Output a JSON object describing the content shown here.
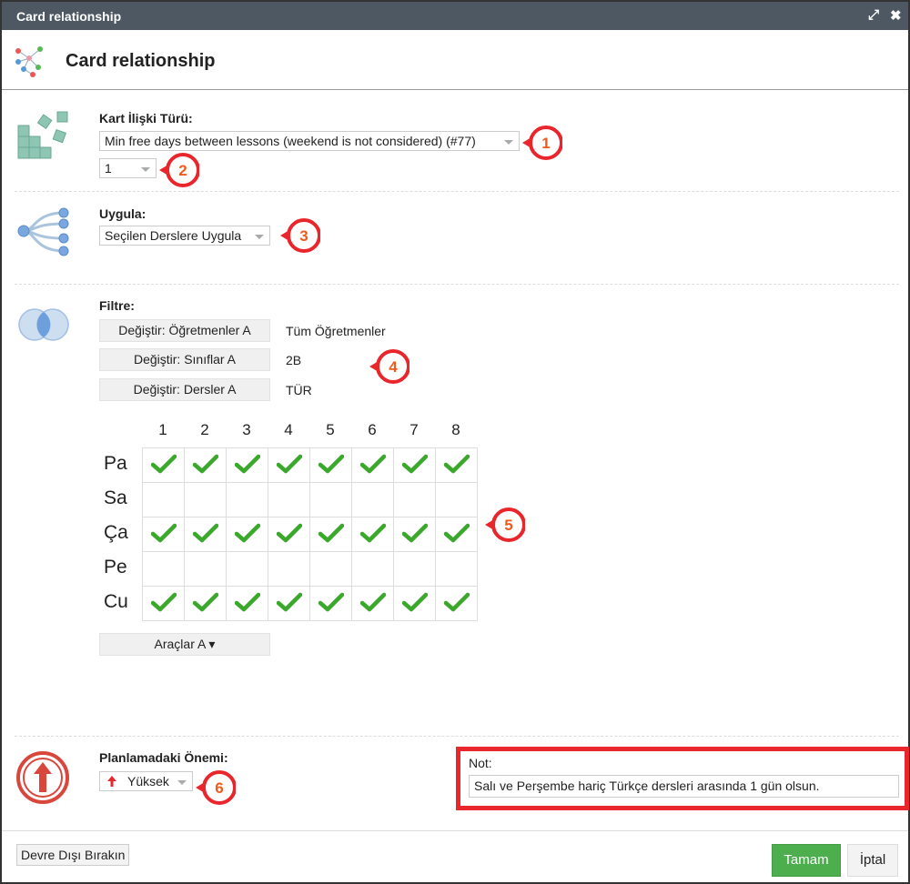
{
  "window": {
    "title": "Card relationship"
  },
  "header": {
    "title": "Card relationship"
  },
  "relation": {
    "label": "Kart İlişki Türü:",
    "type_value": "Min free days between lessons (weekend is not considered) (#77)",
    "count_value": "1"
  },
  "apply": {
    "label": "Uygula:",
    "value": "Seçilen Derslere Uygula"
  },
  "filter": {
    "label": "Filtre:",
    "rows": [
      {
        "button": "Değiştir: Öğretmenler A",
        "value": "Tüm Öğretmenler"
      },
      {
        "button": "Değiştir: Sınıflar A",
        "value": "2B"
      },
      {
        "button": "Değiştir: Dersler A",
        "value": "TÜR"
      }
    ]
  },
  "grid": {
    "columns": [
      "1",
      "2",
      "3",
      "4",
      "5",
      "6",
      "7",
      "8"
    ],
    "rows": [
      {
        "day": "Pa",
        "checks": [
          true,
          true,
          true,
          true,
          true,
          true,
          true,
          true
        ]
      },
      {
        "day": "Sa",
        "checks": [
          false,
          false,
          false,
          false,
          false,
          false,
          false,
          false
        ]
      },
      {
        "day": "Ça",
        "checks": [
          true,
          true,
          true,
          true,
          true,
          true,
          true,
          true
        ]
      },
      {
        "day": "Pe",
        "checks": [
          false,
          false,
          false,
          false,
          false,
          false,
          false,
          false
        ]
      },
      {
        "day": "Cu",
        "checks": [
          true,
          true,
          true,
          true,
          true,
          true,
          true,
          true
        ]
      }
    ],
    "tools_button": "Araçlar A ▾"
  },
  "importance": {
    "label": "Planlamadaki Önemi:",
    "value": "Yüksek"
  },
  "note": {
    "label": "Not:",
    "value": "Salı ve Perşembe hariç Türkçe dersleri arasında 1 gün olsun."
  },
  "markers": [
    "1",
    "2",
    "3",
    "4",
    "5",
    "6"
  ],
  "footer": {
    "disable_label": "Devre Dışı Bırakın",
    "ok_label": "Tamam",
    "cancel_label": "İptal"
  },
  "colors": {
    "titlebar": "#4d5862",
    "ok_button": "#4cae4c",
    "check": "#3aa82a",
    "marker_red": "#e8262b",
    "marker_number": "#f05a1a",
    "note_border": "#e8262b"
  },
  "icons": {
    "expand": "expand-icon",
    "close": "close-icon",
    "header": "card-relationship-icon",
    "relation": "blocks-icon",
    "apply": "tree-icon",
    "filter": "venn-icon",
    "importance": "priority-up-icon"
  }
}
